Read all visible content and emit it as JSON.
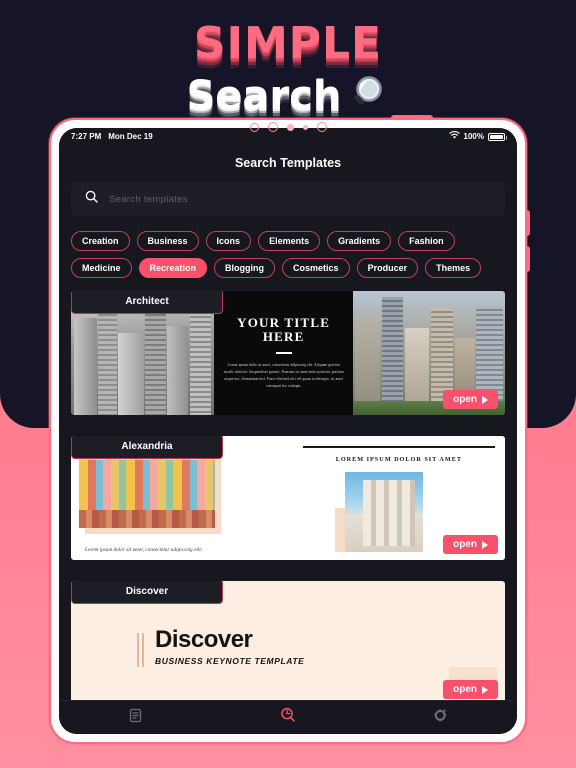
{
  "hero": {
    "line1": "SIMPLE",
    "line2": "Search",
    "icon": "magnifier-icon"
  },
  "device": {
    "statusbar": {
      "time": "7:27 PM",
      "date": "Mon Dec 19",
      "wifi_icon": "wifi-icon",
      "battery_percent": "100%",
      "battery_icon": "battery-full-icon"
    },
    "app": {
      "title": "Search Templates",
      "search": {
        "icon": "search-icon",
        "placeholder": "Search templates",
        "value": ""
      },
      "tags": [
        {
          "label": "Creation",
          "active": false
        },
        {
          "label": "Business",
          "active": false
        },
        {
          "label": "Icons",
          "active": false
        },
        {
          "label": "Elements",
          "active": false
        },
        {
          "label": "Gradients",
          "active": false
        },
        {
          "label": "Fashion",
          "active": false
        },
        {
          "label": "Medicine",
          "active": false
        },
        {
          "label": "Recreation",
          "active": true
        },
        {
          "label": "Blogging",
          "active": false
        },
        {
          "label": "Cosmetics",
          "active": false
        },
        {
          "label": "Producer",
          "active": false
        },
        {
          "label": "Themes",
          "active": false
        }
      ],
      "cards": [
        {
          "badge": "Architect",
          "open_label": "open",
          "title": "YOUR TITLE HERE",
          "body": "Lorem ipsum dolor sit amet, consectetur adipiscing elit. Aliquam gravida iaculis ultricies. Suspendisse potenti. Praesent sit amet enim porttitor, pretium neque nec, fermentum nisl. Fusce eleifend nisi vel quam scelerisque, sit amet consequat leo volutpat."
        },
        {
          "badge": "Alexandria",
          "open_label": "open",
          "heading": "LOREM IPSUM DOLOR SIT AMET",
          "caption": "Lorem ipsum dolor sit amet, consectetur adipiscing elit."
        },
        {
          "badge": "Discover",
          "open_label": "open",
          "title": "Discover",
          "subtitle": "BUSINESS KEYNOTE TEMPLATE"
        }
      ],
      "bottom_nav": [
        {
          "icon": "document-list-icon",
          "active": false
        },
        {
          "icon": "search-icon",
          "active": true
        },
        {
          "icon": "gear-icon",
          "active": false
        }
      ]
    }
  },
  "colors": {
    "accent_pink": "#F9506B",
    "background_dark": "#151527",
    "background_pink": "#FF6B85",
    "screen_bg": "#17171F",
    "tag_border": "#C1425A"
  }
}
